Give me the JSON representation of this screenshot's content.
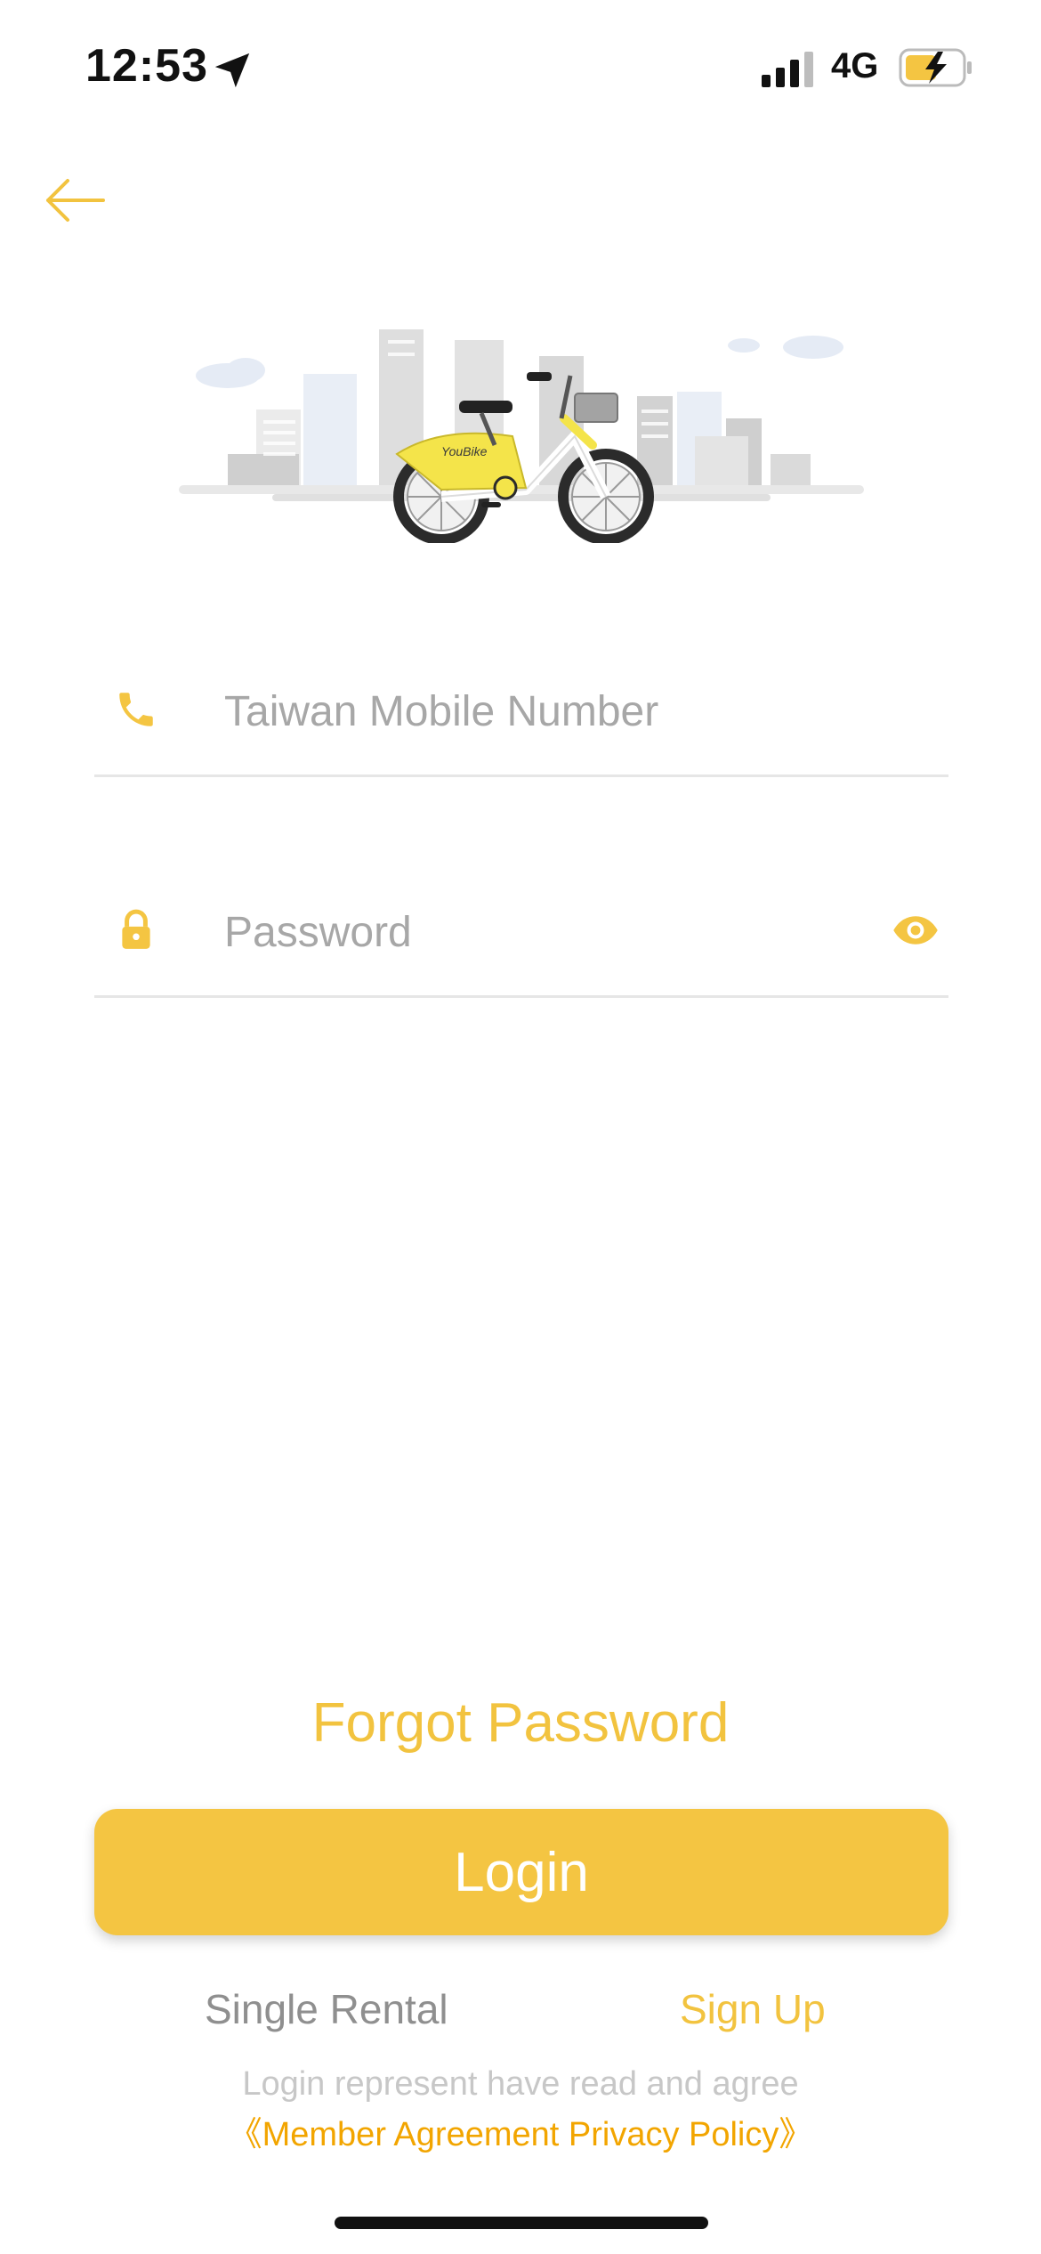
{
  "status_bar": {
    "time": "12:53",
    "network": "4G"
  },
  "icons": {
    "back": "arrow-left-icon",
    "phone": "phone-icon",
    "lock": "lock-icon",
    "eye": "eye-icon",
    "location": "location-arrow-icon",
    "signal": "signal-icon",
    "battery": "battery-charging-icon"
  },
  "form": {
    "phone_placeholder": "Taiwan Mobile Number",
    "password_placeholder": "Password"
  },
  "actions": {
    "forgot": "Forgot Password",
    "login": "Login",
    "single_rental": "Single Rental",
    "sign_up": "Sign Up"
  },
  "legal": {
    "prefix": "Login represent have read and agree",
    "links": "《Member Agreement Privacy Policy》"
  },
  "colors": {
    "accent": "#f4c542",
    "accent_text": "#f2c33f",
    "link": "#f2a500"
  }
}
